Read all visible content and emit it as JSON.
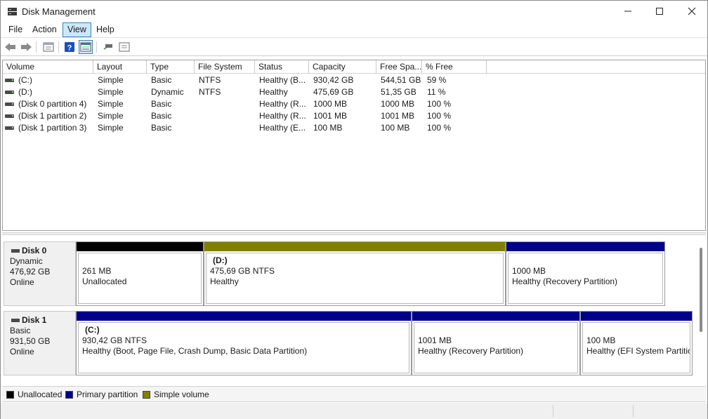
{
  "window": {
    "title": "Disk Management"
  },
  "menu": [
    "File",
    "Action",
    "View",
    "Help"
  ],
  "active_menu": "View",
  "list": {
    "columns": [
      "Volume",
      "Layout",
      "Type",
      "File System",
      "Status",
      "Capacity",
      "Free Spa...",
      "% Free"
    ],
    "rows": [
      [
        "(C:)",
        "Simple",
        "Basic",
        "NTFS",
        "Healthy (B...",
        "930,42 GB",
        "544,51 GB",
        "59 %"
      ],
      [
        "(D:)",
        "Simple",
        "Dynamic",
        "NTFS",
        "Healthy",
        "475,69 GB",
        "51,35 GB",
        "11 %"
      ],
      [
        "(Disk 0 partition 4)",
        "Simple",
        "Basic",
        "",
        "Healthy (R...",
        "1000 MB",
        "1000 MB",
        "100 %"
      ],
      [
        "(Disk 1 partition 2)",
        "Simple",
        "Basic",
        "",
        "Healthy (R...",
        "1001 MB",
        "1001 MB",
        "100 %"
      ],
      [
        "(Disk 1 partition 3)",
        "Simple",
        "Basic",
        "",
        "Healthy (E...",
        "100 MB",
        "100 MB",
        "100 %"
      ]
    ]
  },
  "disks": [
    {
      "name": "Disk 0",
      "type": "Dynamic",
      "size": "476,92 GB",
      "state": "Online",
      "partitions": [
        {
          "name": "",
          "size": "261 MB",
          "status": "Unallocated",
          "kind": "unallocated"
        },
        {
          "name": "(D:)",
          "size": "475,69 GB NTFS",
          "status": "Healthy",
          "kind": "simple"
        },
        {
          "name": "",
          "size": "1000 MB",
          "status": "Healthy (Recovery Partition)",
          "kind": "primary"
        }
      ]
    },
    {
      "name": "Disk 1",
      "type": "Basic",
      "size": "931,50 GB",
      "state": "Online",
      "partitions": [
        {
          "name": "(C:)",
          "size": "930,42 GB NTFS",
          "status": "Healthy (Boot, Page File, Crash Dump, Basic Data Partition)",
          "kind": "primary"
        },
        {
          "name": "",
          "size": "1001 MB",
          "status": "Healthy (Recovery Partition)",
          "kind": "primary"
        },
        {
          "name": "",
          "size": "100 MB",
          "status": "Healthy (EFI System Partitio",
          "kind": "primary"
        }
      ]
    }
  ],
  "legend": [
    {
      "label": "Unallocated",
      "color": "#000000"
    },
    {
      "label": "Primary partition",
      "color": "#00008b"
    },
    {
      "label": "Simple volume",
      "color": "#808000"
    }
  ],
  "colors": {
    "unallocated": "#000000",
    "primary": "#00008b",
    "simple": "#808000"
  },
  "icons": [
    "back-arrow-icon",
    "forward-arrow-icon",
    "properties-icon",
    "help-icon",
    "view-icon",
    "connect-icon",
    "console-icon"
  ]
}
